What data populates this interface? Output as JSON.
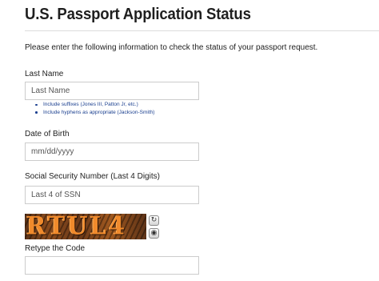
{
  "page": {
    "title": "U.S. Passport Application Status",
    "intro": "Please enter the following information to check the status of your passport request."
  },
  "last_name": {
    "label": "Last Name",
    "placeholder": "Last Name",
    "hints": [
      "Include suffixes (Jones III, Patton Jr, etc.)",
      "Include hyphens as appropriate (Jackson-Smith)"
    ]
  },
  "dob": {
    "label": "Date of Birth",
    "placeholder": "mm/dd/yyyy"
  },
  "ssn": {
    "label": "Social Security Number (Last 4 Digits)",
    "placeholder": "Last 4 of SSN"
  },
  "captcha": {
    "image_text": "RTUL4",
    "refresh_icon": "refresh-icon",
    "audio_icon": "audio-icon",
    "retype_label": "Retype the Code",
    "placeholder": ""
  },
  "colors": {
    "hint_text": "#1a3f8f",
    "field_border": "#cccccc"
  }
}
